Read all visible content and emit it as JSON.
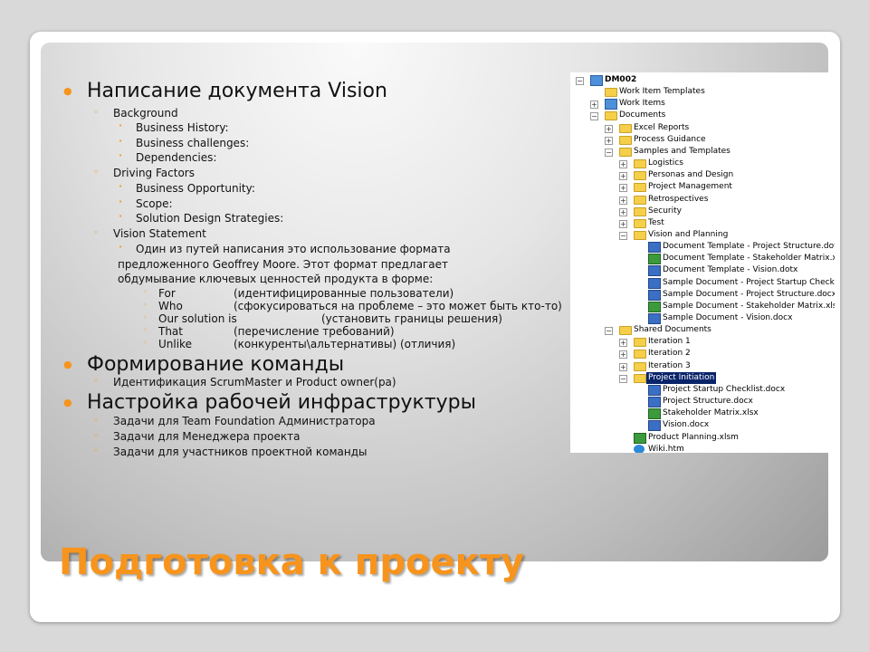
{
  "slide": {
    "title": "Подготовка к проекту",
    "accent": "#f7941d"
  },
  "outline": [
    {
      "level": 1,
      "text": "Написание документа Vision"
    },
    {
      "level": 2,
      "text": "Background"
    },
    {
      "level": 3,
      "text": "Business History:"
    },
    {
      "level": 3,
      "text": "Business challenges:"
    },
    {
      "level": 3,
      "text": "Dependencies:"
    },
    {
      "level": 2,
      "text": "Driving Factors"
    },
    {
      "level": 3,
      "text": "Business Opportunity:"
    },
    {
      "level": 3,
      "text": "Scope:"
    },
    {
      "level": 3,
      "text": "Solution Design Strategies:"
    },
    {
      "level": 2,
      "text": "Vision Statement"
    },
    {
      "level": 3,
      "text": "Один из путей написания это использование формата"
    },
    {
      "level": 0,
      "text": "предложенного  Geoffrey Moore. Этот формат предлагает"
    },
    {
      "level": 0,
      "text": "обдумывание ключевых ценностей продукта в форме:"
    },
    {
      "level": 4,
      "text": "For",
      "desc": "(идентифицированные пользователи)"
    },
    {
      "level": 4,
      "text": "Who",
      "desc": "(сфокусироваться на проблеме –  это может быть кто-то)"
    },
    {
      "level": 4,
      "text": "Our solution is",
      "desc": "(установить границы решения)",
      "wide": true
    },
    {
      "level": 4,
      "text": "That",
      "desc": "(перечисление требований)"
    },
    {
      "level": 4,
      "text": "Unlike",
      "desc": "(конкуренты\\альтернативы) (отличия)"
    },
    {
      "level": 1,
      "text": "Формирование команды"
    },
    {
      "level": 2,
      "text": "Идентификация ScrumMaster и Product owner(ра)"
    },
    {
      "level": 1,
      "text": "Настройка рабочей инфраструктуры"
    },
    {
      "level": 2,
      "text": "Задачи для Team Foundation Администратора"
    },
    {
      "level": 2,
      "text": "Задачи для Менеджера проекта"
    },
    {
      "level": 2,
      "text": "Задачи для участников проектной команды"
    }
  ],
  "tree": [
    {
      "d": 0,
      "t": "-",
      "i": "proj",
      "label": "DM002",
      "bold": true
    },
    {
      "d": 1,
      "t": "",
      "i": "folder",
      "label": "Work Item Templates"
    },
    {
      "d": 1,
      "t": "+",
      "i": "proj",
      "label": "Work Items"
    },
    {
      "d": 1,
      "t": "-",
      "i": "folder",
      "label": "Documents"
    },
    {
      "d": 2,
      "t": "+",
      "i": "folder",
      "label": "Excel Reports"
    },
    {
      "d": 2,
      "t": "+",
      "i": "folder",
      "label": "Process Guidance"
    },
    {
      "d": 2,
      "t": "-",
      "i": "folder",
      "label": "Samples and Templates"
    },
    {
      "d": 3,
      "t": "+",
      "i": "folder",
      "label": "Logistics"
    },
    {
      "d": 3,
      "t": "+",
      "i": "folder",
      "label": "Personas and Design"
    },
    {
      "d": 3,
      "t": "+",
      "i": "folder",
      "label": "Project Management"
    },
    {
      "d": 3,
      "t": "+",
      "i": "folder",
      "label": "Retrospectives"
    },
    {
      "d": 3,
      "t": "+",
      "i": "folder",
      "label": "Security"
    },
    {
      "d": 3,
      "t": "+",
      "i": "folder",
      "label": "Test"
    },
    {
      "d": 3,
      "t": "-",
      "i": "folder",
      "label": "Vision and Planning"
    },
    {
      "d": 4,
      "t": "",
      "i": "word",
      "label": "Document Template - Project Structure.dotx"
    },
    {
      "d": 4,
      "t": "",
      "i": "excel",
      "label": "Document Template - Stakeholder Matrix.xltx"
    },
    {
      "d": 4,
      "t": "",
      "i": "word",
      "label": "Document Template - Vision.dotx"
    },
    {
      "d": 4,
      "t": "",
      "i": "word",
      "label": "Sample Document - Project Startup Checklist.do"
    },
    {
      "d": 4,
      "t": "",
      "i": "word",
      "label": "Sample Document - Project Structure.docx"
    },
    {
      "d": 4,
      "t": "",
      "i": "excel",
      "label": "Sample Document - Stakeholder Matrix.xlsx"
    },
    {
      "d": 4,
      "t": "",
      "i": "word",
      "label": "Sample Document - Vision.docx"
    },
    {
      "d": 2,
      "t": "-",
      "i": "folder",
      "label": "Shared Documents"
    },
    {
      "d": 3,
      "t": "+",
      "i": "folder",
      "label": "Iteration 1"
    },
    {
      "d": 3,
      "t": "+",
      "i": "folder",
      "label": "Iteration 2"
    },
    {
      "d": 3,
      "t": "+",
      "i": "folder",
      "label": "Iteration 3"
    },
    {
      "d": 3,
      "t": "-",
      "i": "folder",
      "label": "Project Initiation",
      "selected": true
    },
    {
      "d": 4,
      "t": "",
      "i": "word",
      "label": "Project Startup Checklist.docx"
    },
    {
      "d": 4,
      "t": "",
      "i": "word",
      "label": "Project Structure.docx"
    },
    {
      "d": 4,
      "t": "",
      "i": "excel",
      "label": "Stakeholder Matrix.xlsx"
    },
    {
      "d": 4,
      "t": "",
      "i": "word",
      "label": "Vision.docx"
    },
    {
      "d": 3,
      "t": "",
      "i": "excel",
      "label": "Product Planning.xlsm"
    },
    {
      "d": 3,
      "t": "",
      "i": "ie",
      "label": "Wiki.htm"
    }
  ]
}
